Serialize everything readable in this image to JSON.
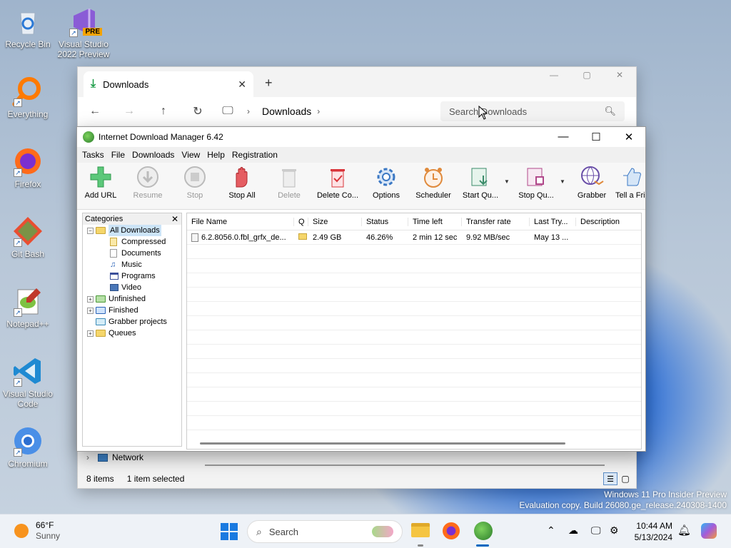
{
  "desktop": {
    "icons": [
      {
        "label": "Recycle Bin"
      },
      {
        "label": "Visual Studio 2022 Preview",
        "badge": "PRE"
      },
      {
        "label": "Everything"
      },
      {
        "label": "Firefox"
      },
      {
        "label": "Git Bash"
      },
      {
        "label": "Notepad++"
      },
      {
        "label": "Visual Studio Code"
      },
      {
        "label": "Chromium"
      }
    ],
    "watermark_line1": "Windows 11 Pro Insider Preview",
    "watermark_line2": "Evaluation copy. Build 26080.ge_release.240308-1400"
  },
  "explorer": {
    "tab_title": "Downloads",
    "breadcrumb": "Downloads",
    "search_placeholder": "Search Downloads",
    "network_label": "Network",
    "status_items": "8 items",
    "status_selected": "1 item selected"
  },
  "idm": {
    "title": "Internet Download Manager 6.42",
    "menu": [
      "Tasks",
      "File",
      "Downloads",
      "View",
      "Help",
      "Registration"
    ],
    "toolbar": [
      {
        "label": "Add URL",
        "icon": "add-url-icon",
        "enabled": true
      },
      {
        "label": "Resume",
        "icon": "resume-icon",
        "enabled": false
      },
      {
        "label": "Stop",
        "icon": "stop-icon",
        "enabled": false
      },
      {
        "label": "Stop All",
        "icon": "stop-all-icon",
        "enabled": true
      },
      {
        "label": "Delete",
        "icon": "delete-icon",
        "enabled": false
      },
      {
        "label": "Delete Co...",
        "icon": "delete-completed-icon",
        "enabled": true
      },
      {
        "label": "Options",
        "icon": "options-gear-icon",
        "enabled": true
      },
      {
        "label": "Scheduler",
        "icon": "scheduler-clock-icon",
        "enabled": true
      },
      {
        "label": "Start Qu...",
        "icon": "start-queue-icon",
        "enabled": true
      },
      {
        "label": "Stop Qu...",
        "icon": "stop-queue-icon",
        "enabled": true
      },
      {
        "label": "Grabber",
        "icon": "grabber-globe-icon",
        "enabled": true
      },
      {
        "label": "Tell a Fri",
        "icon": "tell-a-friend-icon",
        "enabled": true
      }
    ],
    "categories_header": "Categories",
    "categories": {
      "all": "All Downloads",
      "compressed": "Compressed",
      "documents": "Documents",
      "music": "Music",
      "programs": "Programs",
      "video": "Video",
      "unfinished": "Unfinished",
      "finished": "Finished",
      "grabber": "Grabber projects",
      "queues": "Queues"
    },
    "columns": [
      "File Name",
      "Q",
      "Size",
      "Status",
      "Time left",
      "Transfer rate",
      "Last Try...",
      "Description"
    ],
    "rows": [
      {
        "file_name": "6.2.8056.0.fbl_grfx_de...",
        "size": "2.49  GB",
        "status": "46.26%",
        "time_left": "2 min 12 sec",
        "transfer_rate": "9.92  MB/sec",
        "last_try": "May 13 ...",
        "description": ""
      }
    ]
  },
  "taskbar": {
    "weather_temp": "66°F",
    "weather_desc": "Sunny",
    "search_label": "Search",
    "time": "10:44 AM",
    "date": "5/13/2024"
  },
  "colors": {
    "accent": "#0067c0",
    "idm_green": "#3c9a3c",
    "idm_red": "#d9343a"
  }
}
